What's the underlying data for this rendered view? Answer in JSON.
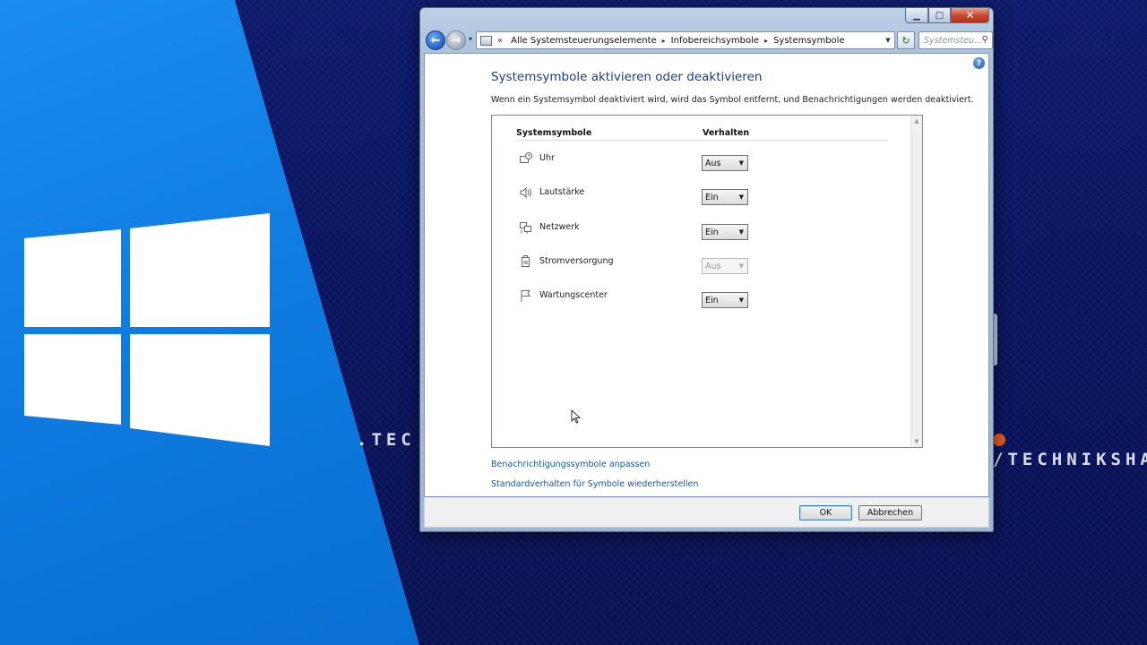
{
  "background": {
    "watermark_left": ".TEC",
    "watermark_right": "/TECHNIKSHAVO"
  },
  "window": {
    "caption_buttons": {
      "minimize": "▁",
      "maximize": "□",
      "close": "✕"
    },
    "address": {
      "chevron": "«",
      "path": [
        "Alle Systemsteuerungselemente",
        "Infobereichsymbole",
        "Systemsymbole"
      ],
      "separator": "▸"
    },
    "search": {
      "placeholder": "Systemsteu..."
    },
    "page_title": "Systemsymbole aktivieren oder deaktivieren",
    "description": "Wenn ein Systemsymbol deaktiviert wird, wird das Symbol entfernt, und Benachrichtigungen werden deaktiviert.",
    "columns": {
      "symbols": "Systemsymbole",
      "behavior": "Verhalten"
    },
    "rows": [
      {
        "label": "Uhr",
        "value": "Aus",
        "icon": "clock-icon",
        "disabled": false
      },
      {
        "label": "Lautstärke",
        "value": "Ein",
        "icon": "speaker-icon",
        "disabled": false
      },
      {
        "label": "Netzwerk",
        "value": "Ein",
        "icon": "network-icon",
        "disabled": false
      },
      {
        "label": "Stromversorgung",
        "value": "Aus",
        "icon": "power-icon",
        "disabled": true
      },
      {
        "label": "Wartungscenter",
        "value": "Ein",
        "icon": "flag-icon",
        "disabled": false
      }
    ],
    "links": {
      "customize": "Benachrichtigungssymbole anpassen",
      "restore": "Standardverhalten für Symbole wiederherstellen"
    },
    "buttons": {
      "ok": "OK",
      "cancel": "Abbrechen"
    }
  },
  "colors": {
    "accent": "#1e3b84",
    "link": "#1b56a8",
    "close_button": "#c8452a",
    "windows_blue": "#0e7be0"
  }
}
